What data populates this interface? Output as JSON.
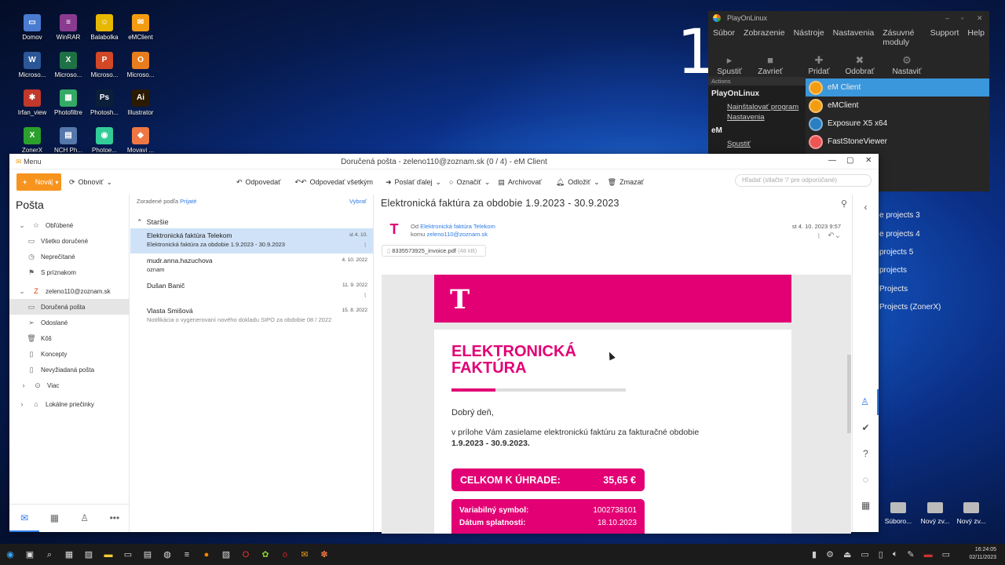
{
  "desktop": {
    "big_number": "1",
    "icons": [
      {
        "label": "Domov",
        "color": "#4a7bd0",
        "glyph": "▭"
      },
      {
        "label": "WinRAR",
        "color": "#8a3b8f",
        "glyph": "≡"
      },
      {
        "label": "Balabolka",
        "color": "#e6b800",
        "glyph": "☺"
      },
      {
        "label": "eMClient",
        "color": "#f39c12",
        "glyph": "✉"
      },
      {
        "label": "Microso...",
        "color": "#2b5797",
        "glyph": "W"
      },
      {
        "label": "Microso...",
        "color": "#1e7145",
        "glyph": "X"
      },
      {
        "label": "Microso...",
        "color": "#d24726",
        "glyph": "P"
      },
      {
        "label": "Microso...",
        "color": "#e87d1e",
        "glyph": "O"
      },
      {
        "label": "Irfan_view",
        "color": "#c0392b",
        "glyph": "✱"
      },
      {
        "label": "Photofiltre",
        "color": "#3a6",
        "glyph": "▦"
      },
      {
        "label": "Photosh...",
        "color": "#0b1f3a",
        "glyph": "Ps"
      },
      {
        "label": "Illustrator",
        "color": "#2b1a00",
        "glyph": "Ai"
      },
      {
        "label": "ZonerX",
        "color": "#2ca02c",
        "glyph": "X"
      },
      {
        "label": "NCH Ph...",
        "color": "#5577aa",
        "glyph": "▤"
      },
      {
        "label": "Photoe...",
        "color": "#3c9",
        "glyph": "◉"
      },
      {
        "label": "Movavi ...",
        "color": "#e74",
        "glyph": "◆"
      }
    ],
    "right_icons": [
      "Súboro...",
      "Nový zv...",
      "Nový zv..."
    ],
    "bg_labels": [
      "e projects 3",
      "e projects 4",
      "projects 5",
      "projects",
      "Projects",
      "Projects (ZonerX)"
    ]
  },
  "pol": {
    "title": "PlayOnLinux",
    "menu": [
      "Súbor",
      "Zobrazenie",
      "Nástroje",
      "Nastavenia",
      "Zásuvné moduly",
      "Support",
      "Help"
    ],
    "tools": [
      "Spustiť",
      "Zavrieť",
      "Pridať",
      "Odobrať",
      "Nastaviť"
    ],
    "left": {
      "section": "Actions",
      "heading": "PlayOnLinux",
      "links": [
        "Nainštalovať program",
        "Nastavenia"
      ],
      "heading2": "eM",
      "link2": "Spustiť"
    },
    "items": [
      "eM Client",
      "eMClient",
      "Exposure X5 x64",
      "FastStoneViewer"
    ]
  },
  "em": {
    "menu": "Menu",
    "window_title": "Doručená pošta - zeleno110@zoznam.sk (0 / 4) - eM Client",
    "toolbar": {
      "new": "Nová",
      "refresh": "Obnoviť",
      "reply": "Odpovedať",
      "reply_all": "Odpovedať všetkým",
      "forward": "Poslať ďalej",
      "mark": "Označiť",
      "archive": "Archivovať",
      "snooze": "Odložiť",
      "delete": "Zmazať",
      "search_placeholder": "Hľadať (stlačte '/' pre odporúčané)"
    },
    "nav": {
      "title": "Pošta",
      "favorites": "Obľúbené",
      "fav_items": [
        "Všetko doručené",
        "Neprečítané",
        "S príznakom"
      ],
      "account": "zeleno110@zoznam.sk",
      "account_items": [
        "Doručená pošta",
        "Odoslané",
        "Kôš",
        "Koncepty",
        "Nevyžiadaná pošta",
        "Viac"
      ],
      "local": "Lokálne priečinky"
    },
    "list": {
      "sort_prefix": "Zoradené podľa",
      "sort_value": "Prijaté",
      "select": "Vybrať",
      "group": "Staršie",
      "messages": [
        {
          "from": "Elektronická faktúra Telekom",
          "subject": "Elektronická faktúra za obdobie 1.9.2023 - 30.9.2023",
          "date": "st 4. 10.",
          "clip": "yes"
        },
        {
          "from": "mudr.anna.hazuchova",
          "subject": "oznam",
          "date": "4. 10. 2022",
          "clip": ""
        },
        {
          "from": "Dušan Banič",
          "subject": "",
          "date": "11. 9. 2022",
          "clip": "yes"
        },
        {
          "from": "Vlasta Smišová",
          "subject": "Notifikácia o vygenerovaní nového dokladu SIPO za obdobie 08 / 2022",
          "date": "15. 8. 2022",
          "clip": ""
        }
      ]
    },
    "reading": {
      "subject": "Elektronická faktúra za obdobie 1.9.2023 - 30.9.2023",
      "from_label": "Od",
      "from": "Elektronická faktúra Telekom",
      "to_label": "komu",
      "to": "zeleno110@zoznam.sk",
      "date": "st 4. 10. 2023 9:57",
      "attachment": "8335573925_invoice.pdf",
      "attachment_size": "(48 kB)",
      "body": {
        "logo": "T",
        "heading1": "ELEKTRONICKÁ",
        "heading2": "FAKTÚRA",
        "progress": 0.25,
        "greeting": "Dobrý deň,",
        "text": "v prílohe Vám zasielame elektronickú faktúru za fakturačné obdobie",
        "period": "1.9.2023 - 30.9.2023.",
        "total_label": "CELKOM K ÚHRADE:",
        "total": "35,65 €",
        "vs_label": "Variabilný symbol:",
        "vs": "1002738101",
        "due_label": "Dátum splatnosti:",
        "due": "18.10.2023"
      }
    }
  },
  "taskbar": {
    "time": "16:24:05",
    "date": "02/11/2023"
  }
}
